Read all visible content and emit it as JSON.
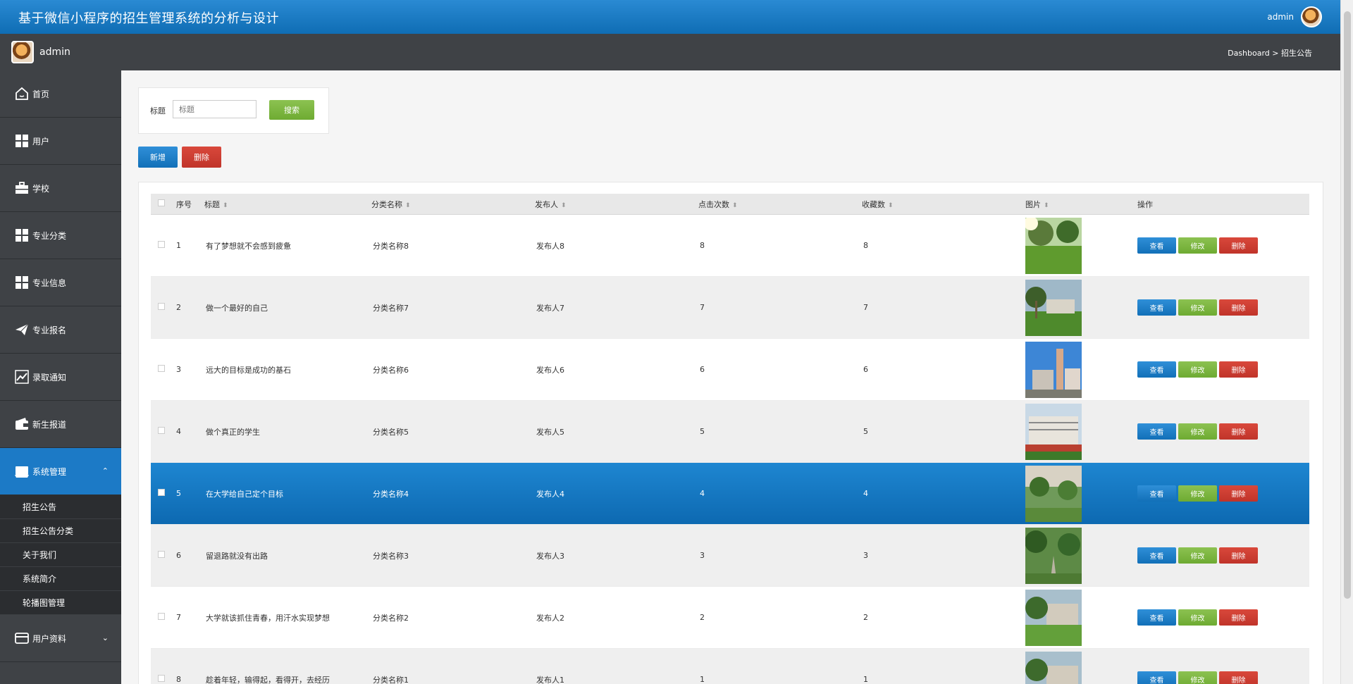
{
  "header": {
    "title": "基于微信小程序的招生管理系统的分析与设计",
    "user": "admin"
  },
  "subbar": {
    "user": "admin",
    "breadcrumb": "Dashboard > 招生公告"
  },
  "sidebar": {
    "items": [
      {
        "label": "首页",
        "icon": "home-icon"
      },
      {
        "label": "用户",
        "icon": "grid-icon"
      },
      {
        "label": "学校",
        "icon": "briefcase-icon"
      },
      {
        "label": "专业分类",
        "icon": "grid-icon"
      },
      {
        "label": "专业信息",
        "icon": "grid-icon"
      },
      {
        "label": "专业报名",
        "icon": "paper-plane-icon"
      },
      {
        "label": "录取通知",
        "icon": "chart-icon"
      },
      {
        "label": "新生报道",
        "icon": "wallet-icon"
      },
      {
        "label": "系统管理",
        "icon": "store-icon",
        "caret": "⌃"
      }
    ],
    "subitems": [
      "招生公告",
      "招生公告分类",
      "关于我们",
      "系统简介",
      "轮播图管理"
    ],
    "last": {
      "label": "用户资料",
      "icon": "card-icon",
      "caret": "⌄"
    }
  },
  "search": {
    "label": "标题",
    "placeholder": "标题",
    "button": "搜索"
  },
  "toolbar": {
    "add": "新增",
    "delete": "删除"
  },
  "table": {
    "headers": {
      "no": "序号",
      "title": "标题",
      "category": "分类名称",
      "publisher": "发布人",
      "clicks": "点击次数",
      "favorites": "收藏数",
      "image": "图片",
      "actions": "操作"
    },
    "actions": {
      "view": "查看",
      "edit": "修改",
      "delete": "删除"
    },
    "rows": [
      {
        "no": "1",
        "title": "有了梦想就不会感到疲惫",
        "category": "分类名称8",
        "publisher": "发布人8",
        "clicks": "8",
        "favorites": "8"
      },
      {
        "no": "2",
        "title": "做一个最好的自己",
        "category": "分类名称7",
        "publisher": "发布人7",
        "clicks": "7",
        "favorites": "7"
      },
      {
        "no": "3",
        "title": "远大的目标是成功的基石",
        "category": "分类名称6",
        "publisher": "发布人6",
        "clicks": "6",
        "favorites": "6"
      },
      {
        "no": "4",
        "title": "做个真正的学生",
        "category": "分类名称5",
        "publisher": "发布人5",
        "clicks": "5",
        "favorites": "5"
      },
      {
        "no": "5",
        "title": "在大学给自己定个目标",
        "category": "分类名称4",
        "publisher": "发布人4",
        "clicks": "4",
        "favorites": "4"
      },
      {
        "no": "6",
        "title": "留退路就没有出路",
        "category": "分类名称3",
        "publisher": "发布人3",
        "clicks": "3",
        "favorites": "3"
      },
      {
        "no": "7",
        "title": "大学就该抓住青春，用汗水实现梦想",
        "category": "分类名称2",
        "publisher": "发布人2",
        "clicks": "2",
        "favorites": "2"
      },
      {
        "no": "8",
        "title": "趁着年轻，输得起，看得开，去经历",
        "category": "分类名称1",
        "publisher": "发布人1",
        "clicks": "1",
        "favorites": "1"
      }
    ]
  },
  "colors": {
    "primary": "#1c7ac6",
    "sidebar": "#3f4246",
    "success": "#7ab53f",
    "danger": "#c9382d"
  }
}
